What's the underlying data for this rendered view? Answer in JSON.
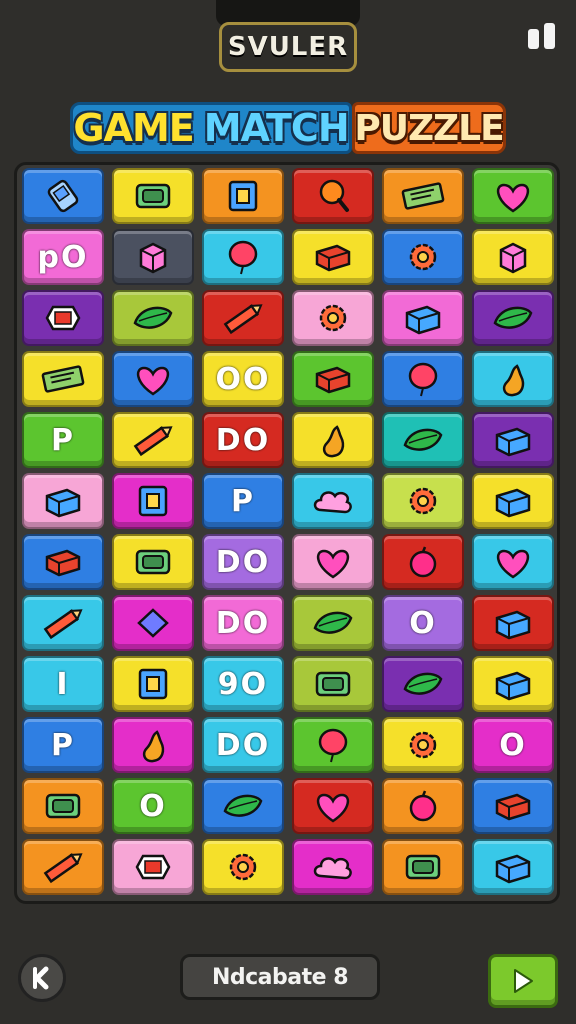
{
  "header": {
    "top_label": "SVULER",
    "title_part1": "GAME",
    "title_part2": "MATCH",
    "title_part3": "PUZZLE"
  },
  "footer": {
    "bottom_label": "Ndcabate 8"
  },
  "colors": {
    "blue": "#2f7fe3",
    "yellow": "#f5e02a",
    "orange": "#f49320",
    "red": "#d52a21",
    "green": "#5cc52f",
    "pink": "#f26ad6",
    "darkgray": "#4b5160",
    "cyan": "#38c8e8",
    "purple": "#7a2fb0",
    "olive": "#a8c83a",
    "magenta": "#e42ec9",
    "lpink": "#f7a6d6",
    "violet": "#a46be0",
    "lime": "#c7e04d",
    "teal": "#1fc0b5"
  },
  "board": {
    "columns": 6,
    "rows": 12,
    "tiles": [
      {
        "bg": "blue",
        "icon": "phone"
      },
      {
        "bg": "yellow",
        "icon": "tray"
      },
      {
        "bg": "orange",
        "icon": "frame"
      },
      {
        "bg": "red",
        "icon": "magnifier"
      },
      {
        "bg": "orange",
        "icon": "ticket"
      },
      {
        "bg": "green",
        "icon": "heart"
      },
      {
        "bg": "pink",
        "text": "pO"
      },
      {
        "bg": "darkgray",
        "icon": "cube"
      },
      {
        "bg": "cyan",
        "icon": "balloon"
      },
      {
        "bg": "yellow",
        "icon": "book"
      },
      {
        "bg": "blue",
        "icon": "cog"
      },
      {
        "bg": "yellow",
        "icon": "cube"
      },
      {
        "bg": "purple",
        "icon": "badge"
      },
      {
        "bg": "olive",
        "icon": "leaf"
      },
      {
        "bg": "red",
        "icon": "pencil"
      },
      {
        "bg": "lpink",
        "icon": "cog"
      },
      {
        "bg": "pink",
        "icon": "box"
      },
      {
        "bg": "purple",
        "icon": "leaf"
      },
      {
        "bg": "yellow",
        "icon": "ticket"
      },
      {
        "bg": "blue",
        "icon": "heart"
      },
      {
        "bg": "yellow",
        "text": "OO"
      },
      {
        "bg": "green",
        "icon": "book"
      },
      {
        "bg": "blue",
        "icon": "balloon"
      },
      {
        "bg": "cyan",
        "icon": "pear"
      },
      {
        "bg": "green",
        "text": "P"
      },
      {
        "bg": "yellow",
        "icon": "pencil"
      },
      {
        "bg": "red",
        "text": "DO"
      },
      {
        "bg": "yellow",
        "icon": "pear"
      },
      {
        "bg": "teal",
        "icon": "leaf"
      },
      {
        "bg": "purple",
        "icon": "box"
      },
      {
        "bg": "lpink",
        "icon": "box"
      },
      {
        "bg": "magenta",
        "icon": "frame"
      },
      {
        "bg": "blue",
        "text": "P"
      },
      {
        "bg": "cyan",
        "icon": "cloud"
      },
      {
        "bg": "lime",
        "icon": "cog"
      },
      {
        "bg": "yellow",
        "icon": "box"
      },
      {
        "bg": "blue",
        "icon": "book"
      },
      {
        "bg": "yellow",
        "icon": "tray"
      },
      {
        "bg": "violet",
        "text": "DO"
      },
      {
        "bg": "lpink",
        "icon": "heart"
      },
      {
        "bg": "red",
        "icon": "apple"
      },
      {
        "bg": "cyan",
        "icon": "heart"
      },
      {
        "bg": "cyan",
        "icon": "pencil"
      },
      {
        "bg": "magenta",
        "icon": "diamond"
      },
      {
        "bg": "pink",
        "text": "DO"
      },
      {
        "bg": "olive",
        "icon": "leaf"
      },
      {
        "bg": "violet",
        "text": "O"
      },
      {
        "bg": "red",
        "icon": "box"
      },
      {
        "bg": "cyan",
        "text": "I"
      },
      {
        "bg": "yellow",
        "icon": "frame"
      },
      {
        "bg": "cyan",
        "text": "9O"
      },
      {
        "bg": "olive",
        "icon": "tray"
      },
      {
        "bg": "purple",
        "icon": "leaf"
      },
      {
        "bg": "yellow",
        "icon": "box"
      },
      {
        "bg": "blue",
        "text": "P"
      },
      {
        "bg": "magenta",
        "icon": "pear"
      },
      {
        "bg": "cyan",
        "text": "DO"
      },
      {
        "bg": "green",
        "icon": "balloon"
      },
      {
        "bg": "yellow",
        "icon": "cog"
      },
      {
        "bg": "magenta",
        "text": "O"
      },
      {
        "bg": "orange",
        "icon": "tray"
      },
      {
        "bg": "green",
        "text": "O"
      },
      {
        "bg": "blue",
        "icon": "leaf"
      },
      {
        "bg": "red",
        "icon": "heart"
      },
      {
        "bg": "orange",
        "icon": "apple"
      },
      {
        "bg": "blue",
        "icon": "book"
      },
      {
        "bg": "orange",
        "icon": "pencil"
      },
      {
        "bg": "lpink",
        "icon": "badge"
      },
      {
        "bg": "yellow",
        "icon": "cog"
      },
      {
        "bg": "magenta",
        "icon": "cloud"
      },
      {
        "bg": "orange",
        "icon": "tray"
      },
      {
        "bg": "cyan",
        "icon": "box"
      }
    ]
  }
}
